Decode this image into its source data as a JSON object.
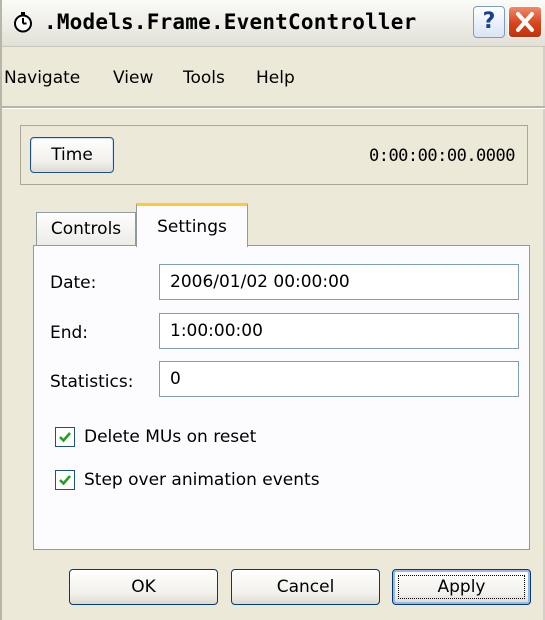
{
  "window": {
    "title": ".Models.Frame.EventController",
    "help_label": "?"
  },
  "menu": {
    "items": [
      "Navigate",
      "View",
      "Tools",
      "Help"
    ]
  },
  "time": {
    "button_label": "Time",
    "value": "0:00:00:00.0000"
  },
  "tabs": [
    {
      "label": "Controls",
      "active": false
    },
    {
      "label": "Settings",
      "active": true
    }
  ],
  "settings": {
    "date_label": "Date:",
    "date_value": "2006/01/02 00:00:00",
    "end_label": "End:",
    "end_value": "1:00:00:00",
    "statistics_label": "Statistics:",
    "statistics_value": "0",
    "delete_mus": {
      "label": "Delete MUs on reset",
      "checked": true
    },
    "step_over": {
      "label": "Step over animation events",
      "checked": true
    }
  },
  "buttons": {
    "ok": "OK",
    "cancel": "Cancel",
    "apply": "Apply"
  },
  "icons": {
    "app": "stopwatch-icon",
    "help": "help-icon",
    "close": "close-icon",
    "check": "checkmark-icon"
  },
  "colors": {
    "close_button": "#d8431b",
    "active_tab_accent": "#ffc83c",
    "check": "#21a121"
  }
}
